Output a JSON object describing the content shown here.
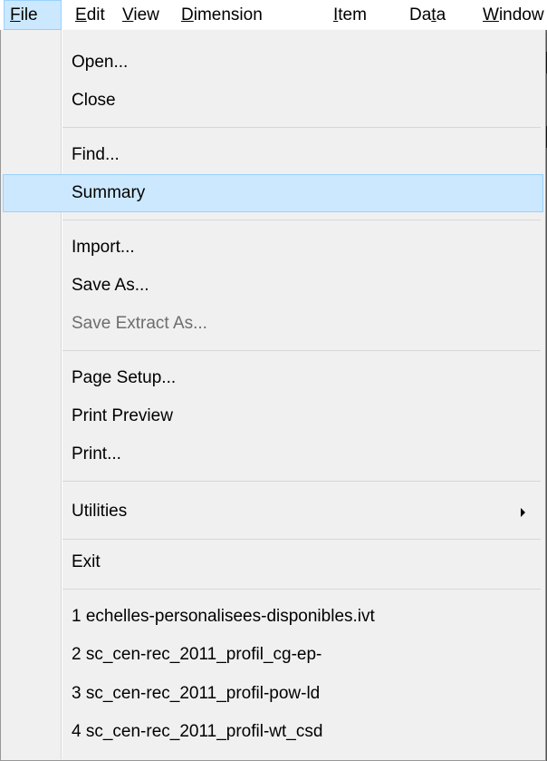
{
  "menubar": {
    "items": [
      {
        "pre": "",
        "key": "F",
        "post": "ile"
      },
      {
        "pre": "",
        "key": "E",
        "post": "dit"
      },
      {
        "pre": "",
        "key": "V",
        "post": "iew"
      },
      {
        "pre": "",
        "key": "D",
        "post": "imension"
      },
      {
        "pre": "",
        "key": "I",
        "post": "tem"
      },
      {
        "pre": "Da",
        "key": "t",
        "post": "a"
      },
      {
        "pre": "",
        "key": "W",
        "post": "indow"
      }
    ]
  },
  "file_menu": {
    "items": [
      {
        "label": "Open...",
        "enabled": true
      },
      {
        "label": "Close",
        "enabled": true
      },
      {
        "label": "Find...",
        "enabled": true
      },
      {
        "label": "Summary",
        "enabled": true,
        "highlighted": true
      },
      {
        "label": "Import...",
        "enabled": true
      },
      {
        "label": "Save As...",
        "enabled": true
      },
      {
        "label": "Save Extract As...",
        "enabled": false
      },
      {
        "label": "Page Setup...",
        "enabled": true
      },
      {
        "label": "Print Preview",
        "enabled": true
      },
      {
        "label": "Print...",
        "enabled": true
      },
      {
        "label": "Utilities",
        "enabled": true,
        "submenu": true
      },
      {
        "label": "Exit",
        "enabled": true
      }
    ],
    "recent_files": [
      "1 echelles-personalisees-disponibles.ivt",
      "2 sc_cen-rec_2011_profil_cg-ep-",
      "3 sc_cen-rec_2011_profil-pow-ld",
      "4 sc_cen-rec_2011_profil-wt_csd"
    ]
  },
  "colors": {
    "highlight_fill": "#cce8ff",
    "highlight_border": "#99d1ff",
    "menu_bg": "#f0f0f0",
    "disabled_text": "#6d6d6d"
  }
}
